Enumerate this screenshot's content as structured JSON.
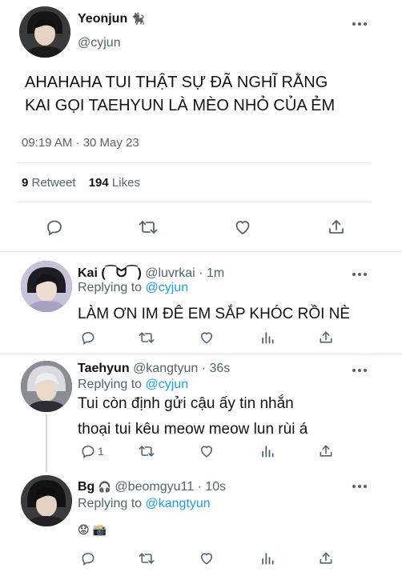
{
  "main_tweet": {
    "name": "Yeonjun",
    "name_emoji": "🐈‍⬛",
    "handle": "@cyjun",
    "text_line1": "AHAHAHA TUI THẬT SỰ ĐÃ NGHĨ RẰNG",
    "text_line2": "KAI GỌI TAEHYUN LÀ MÈO NHỎ CỦA ẺM",
    "timestamp": "09:19 AM · 30 May 23",
    "retweet_count": "9",
    "retweet_label": "Retweet",
    "like_count": "194",
    "like_label": "Likes"
  },
  "replies": [
    {
      "name": "Kai",
      "name_suffix": "(⁀ᗢ⁀)",
      "handle": "@luvrkai",
      "dot": "·",
      "time": "1m",
      "replying_prefix": "Replying to",
      "replying_to": "@cyjun",
      "text_line1": "LÀM ƠN IM ĐÊ EM SẮP KHÓC RỒI NÈ",
      "text_line2": "",
      "reply_count": ""
    },
    {
      "name": "Taehyun",
      "name_suffix": "",
      "handle": "@kangtyun",
      "dot": "·",
      "time": "36s",
      "replying_prefix": "Replying to",
      "replying_to": "@cyjun",
      "text_line1": "Tui còn định gửi cậu ấy tin nhắn",
      "text_line2": "thoại tui kêu meow meow lun rùi á",
      "reply_count": "1"
    },
    {
      "name": "Bg",
      "name_suffix": "🎧",
      "handle": "@beomgyu11",
      "dot": "·",
      "time": "10s",
      "replying_prefix": "Replying to",
      "replying_to": "@kangtyun",
      "text_line1": "😟 📸",
      "text_line2": "",
      "reply_count": ""
    }
  ],
  "colors": {
    "link": "#1d9bf0",
    "muted": "#536471",
    "divider": "#e6ecf0"
  },
  "icons": [
    "reply-icon",
    "retweet-icon",
    "like-icon",
    "share-icon",
    "analytics-icon",
    "more-icon"
  ]
}
